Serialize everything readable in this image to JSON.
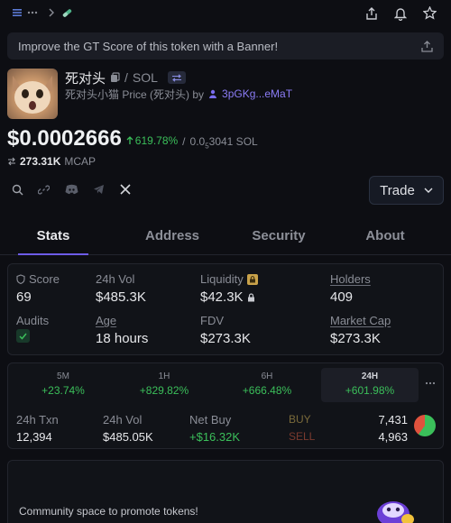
{
  "banner": {
    "text": "Improve the GT Score of this token with a Banner!"
  },
  "token": {
    "name": "死对头",
    "pair_quote": "SOL",
    "subtitle": "死对头小猫 Price (死对头) by",
    "creator": "3pGKg...eMaT",
    "price": "$0.0002666",
    "change": "619.78%",
    "separator": "/",
    "price_sol": "0.0",
    "price_sol_sub": "5",
    "price_sol_rest": "3041 SOL",
    "mcap_value": "273.31K",
    "mcap_label": "MCAP"
  },
  "trade": {
    "label": "Trade"
  },
  "tabs": [
    "Stats",
    "Address",
    "Security",
    "About"
  ],
  "stats": {
    "score": {
      "label": "Score",
      "value": "69"
    },
    "vol24": {
      "label": "24h Vol",
      "value": "$485.3K"
    },
    "liquidity": {
      "label": "Liquidity",
      "value": "$42.3K"
    },
    "holders": {
      "label": "Holders",
      "value": "409"
    },
    "audits": {
      "label": "Audits"
    },
    "age": {
      "label": "Age",
      "value": "18 hours"
    },
    "fdv": {
      "label": "FDV",
      "value": "$273.3K"
    },
    "mcap": {
      "label": "Market Cap",
      "value": "$273.3K"
    }
  },
  "periods": [
    {
      "label": "5M",
      "pct": "+23.74%"
    },
    {
      "label": "1H",
      "pct": "+829.82%"
    },
    {
      "label": "6H",
      "pct": "+666.48%"
    },
    {
      "label": "24H",
      "pct": "+601.98%"
    }
  ],
  "txn": {
    "txn_label": "24h Txn",
    "txn_value": "12,394",
    "vol_label": "24h Vol",
    "vol_value": "$485.05K",
    "net_label": "Net Buy",
    "net_value": "+$16.32K",
    "buy_label": "BUY",
    "buy_value": "7,431",
    "sell_label": "SELL",
    "sell_value": "4,963",
    "buy_share": 0.6
  },
  "community": {
    "text": "Community space to promote tokens!"
  },
  "colors": {
    "accent": "#6d5ce7",
    "green": "#3bbf5a",
    "red": "#e0523d",
    "score": "#e58a3a"
  }
}
